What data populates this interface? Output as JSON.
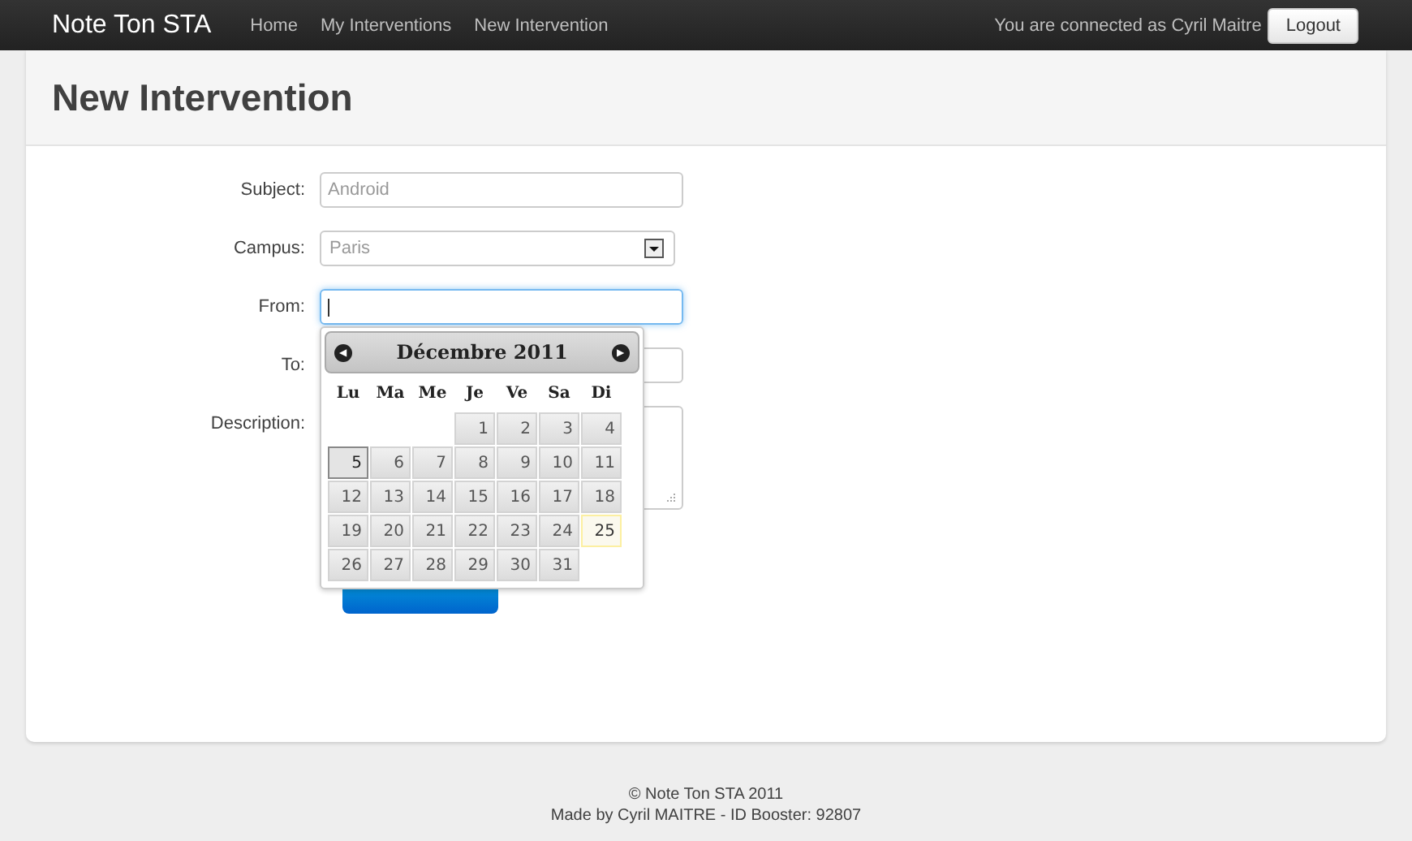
{
  "navbar": {
    "brand": "Note Ton STA",
    "links": [
      {
        "label": "Home"
      },
      {
        "label": "My Interventions"
      },
      {
        "label": "New Intervention"
      }
    ],
    "user_text": "You are connected as Cyril Maitre",
    "logout": "Logout"
  },
  "page": {
    "title": "New Intervention"
  },
  "form": {
    "fields": [
      {
        "kind": "text",
        "label": "Subject:",
        "placeholder": "Android",
        "focused": false
      },
      {
        "kind": "select",
        "label": "Campus:",
        "value": "Paris"
      },
      {
        "kind": "text",
        "label": "From:",
        "focused": true
      },
      {
        "kind": "text",
        "label": "To:",
        "focused": false
      },
      {
        "kind": "textarea",
        "label": "Description:"
      }
    ]
  },
  "datepicker": {
    "prev": "◀",
    "month": "Décembre 2011",
    "next": "▶",
    "weekdays": [
      "Lu",
      "Ma",
      "Me",
      "Je",
      "Ve",
      "Sa",
      "Di"
    ],
    "weeks": [
      [
        {
          "kind": "blank"
        },
        {
          "kind": "blank"
        },
        {
          "kind": "blank"
        },
        {
          "kind": "day",
          "day": "1",
          "selected": false,
          "today": false
        },
        {
          "kind": "day",
          "day": "2",
          "selected": false,
          "today": false
        },
        {
          "kind": "day",
          "day": "3",
          "selected": false,
          "today": false
        },
        {
          "kind": "day",
          "day": "4",
          "selected": false,
          "today": false
        }
      ],
      [
        {
          "kind": "day",
          "day": "5",
          "selected": true,
          "today": false
        },
        {
          "kind": "day",
          "day": "6",
          "selected": false,
          "today": false
        },
        {
          "kind": "day",
          "day": "7",
          "selected": false,
          "today": false
        },
        {
          "kind": "day",
          "day": "8",
          "selected": false,
          "today": false
        },
        {
          "kind": "day",
          "day": "9",
          "selected": false,
          "today": false
        },
        {
          "kind": "day",
          "day": "10",
          "selected": false,
          "today": false
        },
        {
          "kind": "day",
          "day": "11",
          "selected": false,
          "today": false
        }
      ],
      [
        {
          "kind": "day",
          "day": "12",
          "selected": false,
          "today": false
        },
        {
          "kind": "day",
          "day": "13",
          "selected": false,
          "today": false
        },
        {
          "kind": "day",
          "day": "14",
          "selected": false,
          "today": false
        },
        {
          "kind": "day",
          "day": "15",
          "selected": false,
          "today": false
        },
        {
          "kind": "day",
          "day": "16",
          "selected": false,
          "today": false
        },
        {
          "kind": "day",
          "day": "17",
          "selected": false,
          "today": false
        },
        {
          "kind": "day",
          "day": "18",
          "selected": false,
          "today": false
        }
      ],
      [
        {
          "kind": "day",
          "day": "19",
          "selected": false,
          "today": false
        },
        {
          "kind": "day",
          "day": "20",
          "selected": false,
          "today": false
        },
        {
          "kind": "day",
          "day": "21",
          "selected": false,
          "today": false
        },
        {
          "kind": "day",
          "day": "22",
          "selected": false,
          "today": false
        },
        {
          "kind": "day",
          "day": "23",
          "selected": false,
          "today": false
        },
        {
          "kind": "day",
          "day": "24",
          "selected": false,
          "today": false
        },
        {
          "kind": "day",
          "day": "25",
          "selected": false,
          "today": true
        }
      ],
      [
        {
          "kind": "day",
          "day": "26",
          "selected": false,
          "today": false
        },
        {
          "kind": "day",
          "day": "27",
          "selected": false,
          "today": false
        },
        {
          "kind": "day",
          "day": "28",
          "selected": false,
          "today": false
        },
        {
          "kind": "day",
          "day": "29",
          "selected": false,
          "today": false
        },
        {
          "kind": "day",
          "day": "30",
          "selected": false,
          "today": false
        },
        {
          "kind": "day",
          "day": "31",
          "selected": false,
          "today": false
        },
        {
          "kind": "blank"
        }
      ]
    ]
  },
  "footer": {
    "lines": [
      "© Note Ton STA 2011",
      "Made by Cyril MAITRE - ID Booster: 92807"
    ]
  }
}
